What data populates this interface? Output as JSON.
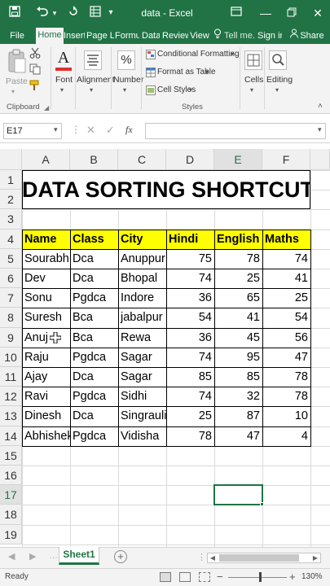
{
  "titlebar": {
    "title": "data - Excel",
    "tell_me": "Tell me...",
    "sign_in": "Sign in",
    "share": "Share"
  },
  "tabs": [
    "File",
    "Home",
    "Insert",
    "Page La",
    "Formul",
    "Data",
    "Review",
    "View"
  ],
  "active_tab": "Home",
  "ribbon": {
    "paste": "Paste",
    "clipboard": "Clipboard",
    "font": "Font",
    "alignment": "Alignment",
    "number": "Number",
    "conditional_formatting": "Conditional Formatting",
    "format_as_table": "Format as Table",
    "cell_styles": "Cell Styles",
    "styles": "Styles",
    "cells": "Cells",
    "editing": "Editing",
    "percent_symbol": "%",
    "font_symbol": "A"
  },
  "formula_bar": {
    "name_box": "E17",
    "fx": "fx",
    "value": ""
  },
  "columns": [
    "A",
    "B",
    "C",
    "D",
    "E",
    "F"
  ],
  "rows": [
    "1",
    "2",
    "3",
    "4",
    "5",
    "6",
    "7",
    "8",
    "9",
    "10",
    "11",
    "12",
    "13",
    "14",
    "15",
    "16",
    "17",
    "18",
    "19"
  ],
  "sheet": {
    "title": "DATA SORTING SHORTCUT",
    "headers": [
      "Name",
      "Class",
      "City",
      "Hindi",
      "English",
      "Maths"
    ],
    "records": [
      [
        "Sourabh",
        "Dca",
        "Anuppur",
        "75",
        "78",
        "74"
      ],
      [
        "Dev",
        "Dca",
        "Bhopal",
        "74",
        "25",
        "41"
      ],
      [
        "Sonu",
        "Pgdca",
        "Indore",
        "36",
        "65",
        "25"
      ],
      [
        "Suresh",
        "Bca",
        "jabalpur",
        "54",
        "41",
        "54"
      ],
      [
        "Anuj",
        "Bca",
        "Rewa",
        "36",
        "45",
        "56"
      ],
      [
        "Raju",
        "Pgdca",
        "Sagar",
        "74",
        "95",
        "47"
      ],
      [
        "Ajay",
        "Dca",
        "Sagar",
        "85",
        "85",
        "78"
      ],
      [
        "Ravi",
        "Pgdca",
        "Sidhi",
        "74",
        "32",
        "78"
      ],
      [
        "Dinesh",
        "Dca",
        "Singrauli",
        "25",
        "87",
        "10"
      ],
      [
        "Abhishek",
        "Pgdca",
        "Vidisha",
        "78",
        "47",
        "4"
      ]
    ]
  },
  "sheet_tabs": {
    "active": "Sheet1",
    "add": "+"
  },
  "status": {
    "ready": "Ready",
    "zoom": "130%"
  },
  "colors": {
    "excel_green": "#217346",
    "header_fill": "#ffff00"
  }
}
